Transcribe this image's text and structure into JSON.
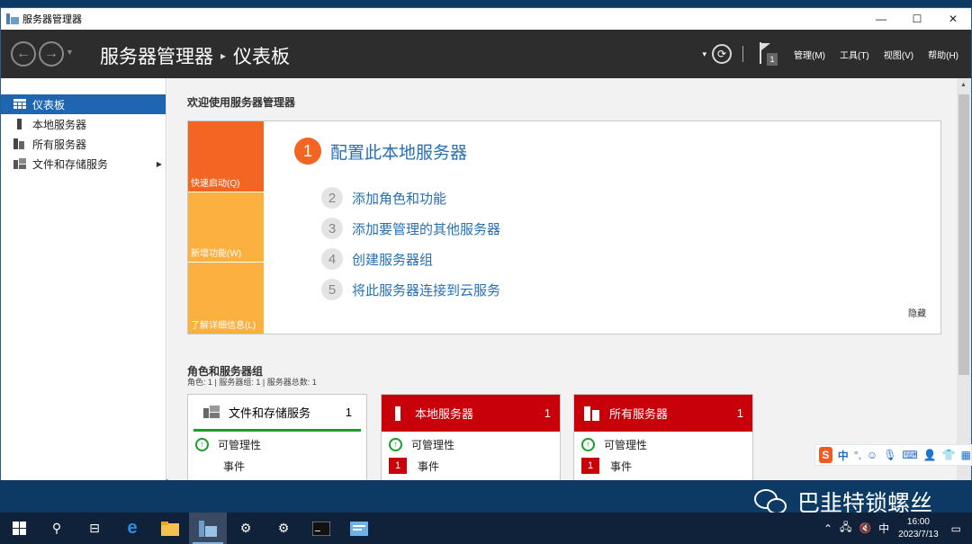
{
  "window": {
    "title": "服务器管理器",
    "controls": {
      "minimize": "—",
      "maximize": "☐",
      "close": "✕"
    }
  },
  "header": {
    "breadcrumb_root": "服务器管理器",
    "breadcrumb_separator": "▸",
    "breadcrumb_current": "仪表板",
    "dropdown_glyph": "▾",
    "notification_count": "1",
    "menus": [
      "管理(M)",
      "工具(T)",
      "视图(V)",
      "帮助(H)"
    ]
  },
  "sidebar": {
    "items": [
      {
        "label": "仪表板",
        "icon": "dashboard-icon",
        "active": true
      },
      {
        "label": "本地服务器",
        "icon": "server-icon"
      },
      {
        "label": "所有服务器",
        "icon": "servers-icon"
      },
      {
        "label": "文件和存储服务",
        "icon": "file-storage-icon",
        "has_submenu": true
      }
    ]
  },
  "welcome": {
    "title": "欢迎使用服务器管理器",
    "tiles": [
      {
        "label": "快速启动(Q)",
        "color": "#f26522"
      },
      {
        "label": "新增功能(W)",
        "color": "#fbb040"
      },
      {
        "label": "了解详细信息(L)",
        "color": "#fbb040"
      }
    ],
    "steps": [
      {
        "num": "1",
        "label": "配置此本地服务器"
      },
      {
        "num": "2",
        "label": "添加角色和功能"
      },
      {
        "num": "3",
        "label": "添加要管理的其他服务器"
      },
      {
        "num": "4",
        "label": "创建服务器组"
      },
      {
        "num": "5",
        "label": "将此服务器连接到云服务"
      }
    ],
    "hide_label": "隐藏"
  },
  "roles": {
    "title": "角色和服务器组",
    "summary": "角色: 1 | 服务器组: 1 | 服务器总数: 1",
    "cards": [
      {
        "title": "文件和存储服务",
        "count": "1",
        "rows": [
          "可管理性",
          "事件"
        ],
        "alert": false
      },
      {
        "title": "本地服务器",
        "count": "1",
        "rows": [
          "可管理性",
          "事件"
        ],
        "event_badge": "1",
        "alert": true
      },
      {
        "title": "所有服务器",
        "count": "1",
        "rows": [
          "可管理性",
          "事件"
        ],
        "event_badge": "1",
        "alert": true
      }
    ]
  },
  "ime_toolbar": {
    "label": "中",
    "punct": "°,"
  },
  "watermark": {
    "text": "巴韭特锁螺丝"
  },
  "taskbar": {
    "tray_ime": "中",
    "time": "16:00",
    "date": "2023/7/13"
  },
  "colors": {
    "accent": "#1e66b1",
    "quick_start": "#f26522",
    "tile_yellow": "#fbb040",
    "alert_red": "#c8000a",
    "header": "#2d2d2d",
    "ok_green": "#18a028"
  }
}
